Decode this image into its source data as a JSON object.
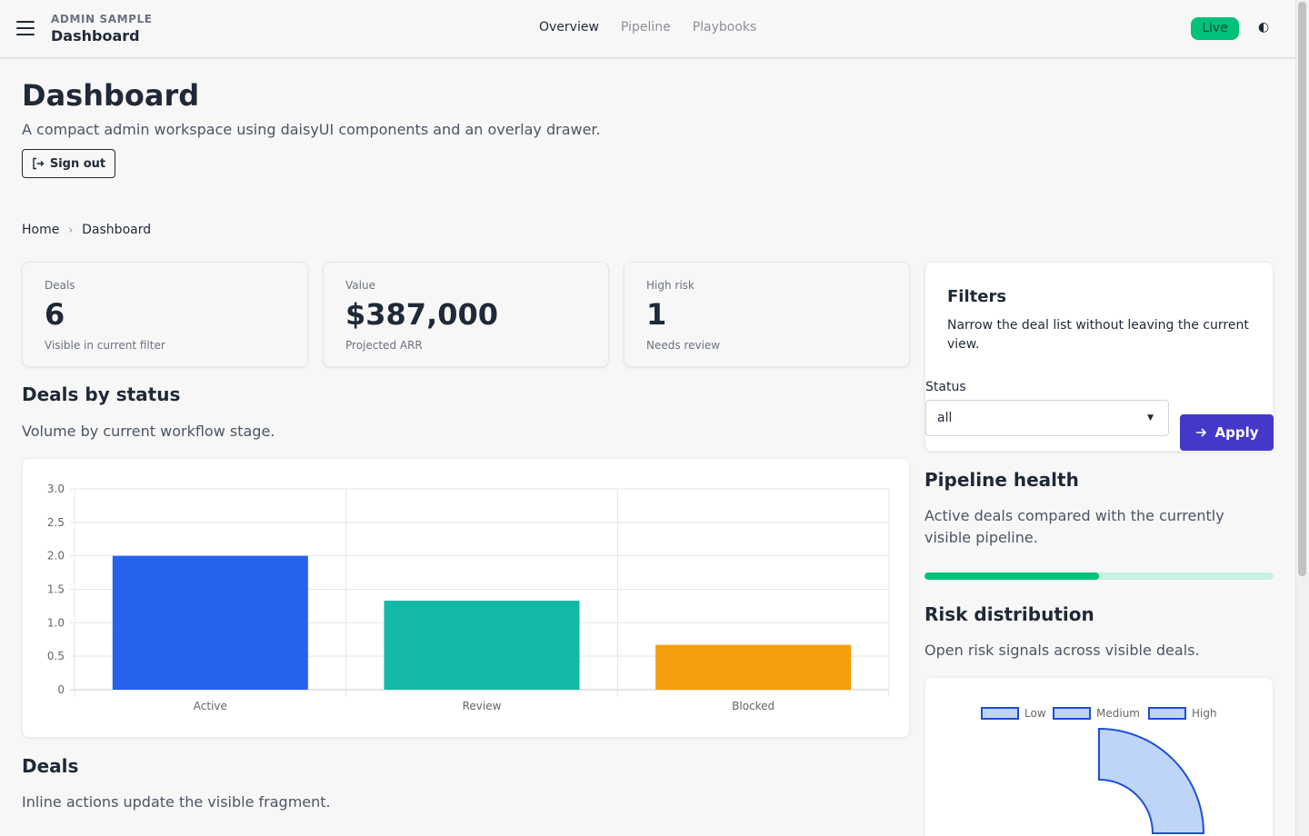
{
  "navbar": {
    "kicker": "ADMIN SAMPLE",
    "title": "Dashboard",
    "links": [
      "Overview",
      "Pipeline",
      "Playbooks"
    ],
    "active_link": "Overview",
    "live_badge": "Live",
    "theme_toggle": "◐"
  },
  "header": {
    "title": "Dashboard",
    "subtitle": "A compact admin workspace using daisyUI components and an overlay drawer.",
    "signout_label": "Sign out"
  },
  "breadcrumb": [
    "Home",
    "Dashboard"
  ],
  "stats": [
    {
      "label": "Deals",
      "value": "6",
      "desc": "Visible in current filter"
    },
    {
      "label": "Value",
      "value": "$387,000",
      "desc": "Projected ARR"
    },
    {
      "label": "High risk",
      "value": "1",
      "desc": "Needs review"
    }
  ],
  "deals_by_status": {
    "title": "Deals by status",
    "desc": "Volume by current workflow stage."
  },
  "chart_data": [
    {
      "type": "bar",
      "categories": [
        "Active",
        "Review",
        "Blocked"
      ],
      "values": [
        2,
        1.33,
        0.67
      ],
      "colors": [
        "#2563eb",
        "#14b8a6",
        "#f59e0b"
      ],
      "yticks": [
        "0",
        "0.5",
        "1.0",
        "1.5",
        "2.0",
        "2.5",
        "3.0"
      ],
      "ylim": [
        0,
        3
      ],
      "grid": true,
      "title": "",
      "xlabel": "",
      "ylabel": ""
    },
    {
      "type": "pie",
      "categories": [
        "Low",
        "Medium",
        "High"
      ],
      "legend": [
        "Low",
        "Medium",
        "High"
      ],
      "legend_position": "top",
      "fill_color": "#bfd4f9",
      "stroke_color": "#1d4ed8"
    }
  ],
  "deals": {
    "title": "Deals",
    "desc": "Inline actions update the visible fragment."
  },
  "filters": {
    "title": "Filters",
    "desc": "Narrow the deal list without leaving the current view.",
    "status_label": "Status",
    "status_value": "all",
    "apply_label": "Apply"
  },
  "pipeline_health": {
    "title": "Pipeline health",
    "desc": "Active deals compared with the currently visible pipeline.",
    "progress_fraction": 0.5
  },
  "risk_distribution": {
    "title": "Risk distribution",
    "desc": "Open risk signals across visible deals."
  }
}
